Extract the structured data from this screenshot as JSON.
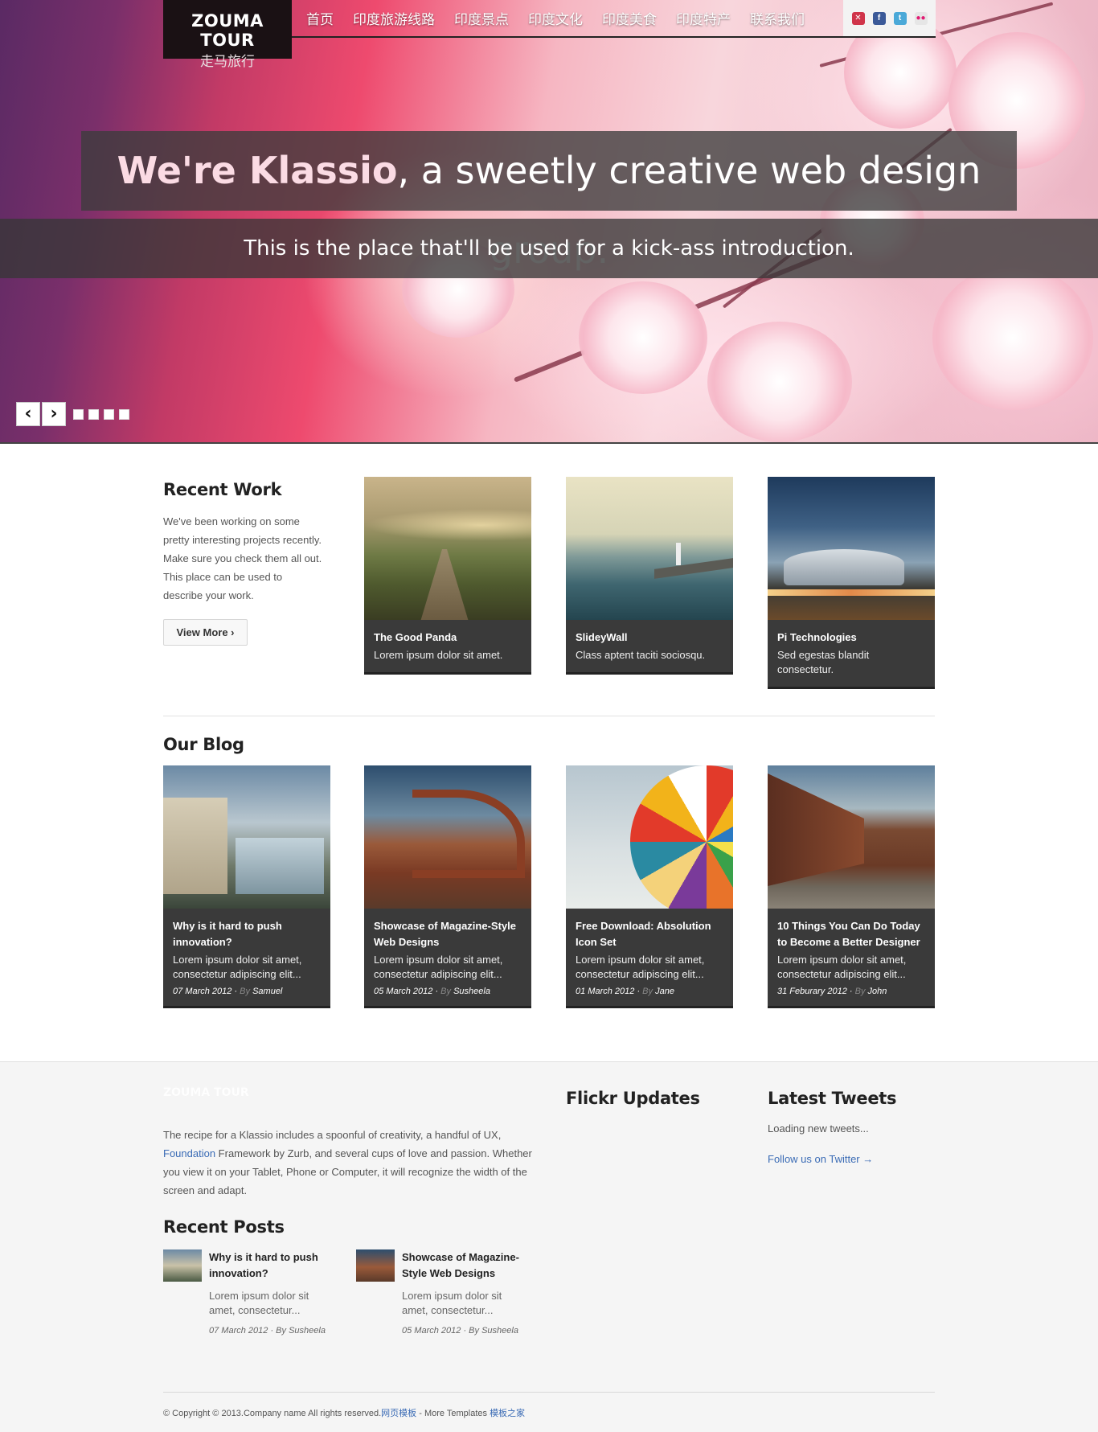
{
  "header": {
    "logo_main": "ZOUMA TOUR",
    "logo_sub": "走马旅行",
    "nav": [
      "首页",
      "印度旅游线路",
      "印度景点",
      "印度文化",
      "印度美食",
      "印度特产",
      "联系我们"
    ]
  },
  "hero": {
    "title_highlight": "We're Klassio",
    "title_rest": ", a sweetly creative web design group.",
    "subtitle": "This is the place that'll be used for a kick-ass introduction.",
    "prev_label": "‹",
    "next_label": "›"
  },
  "recent_work": {
    "heading": "Recent Work",
    "intro": "We've been working on some pretty interesting projects recently. Make sure you check them all out. This place can be used to describe your work.",
    "button": "View More ›",
    "items": [
      {
        "title": "The Good Panda",
        "desc": "Lorem ipsum dolor sit amet."
      },
      {
        "title": "SlideyWall",
        "desc": "Class aptent taciti sociosqu."
      },
      {
        "title": "Pi Technologies",
        "desc": "Sed egestas blandit consectetur."
      }
    ]
  },
  "blog": {
    "heading": "Our Blog",
    "by_label": "By",
    "posts": [
      {
        "title": "Why is it hard to push innovation?",
        "desc": "Lorem ipsum dolor sit amet, consectetur adipiscing elit...",
        "date": "07 March 2012",
        "author": "Samuel"
      },
      {
        "title": "Showcase of Magazine-Style Web Designs",
        "desc": "Lorem ipsum dolor sit amet, consectetur adipiscing elit...",
        "date": "05 March 2012",
        "author": "Susheela"
      },
      {
        "title": "Free Download: Absolution Icon Set",
        "desc": "Lorem ipsum dolor sit amet, consectetur adipiscing elit...",
        "date": "01 March 2012",
        "author": "Jane"
      },
      {
        "title": "10 Things You Can Do Today to Become a Better Designer",
        "desc": "Lorem ipsum dolor sit amet, consectetur adipiscing elit...",
        "date": "31 Feburary 2012",
        "author": "John"
      }
    ]
  },
  "footer": {
    "logo": "ZOUMA TOUR",
    "about_1": "The recipe for a Klassio includes a spoonful of creativity, a handful of UX, ",
    "about_link": "Foundation",
    "about_2": " Framework by Zurb, and several cups of love and passion. Whether you view it on your Tablet, Phone or Computer, it will recognize the width of the screen and adapt.",
    "recent_posts_heading": "Recent Posts",
    "recent_posts": [
      {
        "title": "Why is it hard to push innovation?",
        "desc": "Lorem ipsum dolor sit amet, consectetur...",
        "date": "07 March 2012",
        "author": "Susheela"
      },
      {
        "title": "Showcase of Magazine-Style Web Designs",
        "desc": "Lorem ipsum dolor sit amet, consectetur...",
        "date": "05 March 2012",
        "author": "Susheela"
      }
    ],
    "flickr_heading": "Flickr Updates",
    "tweets_heading": "Latest Tweets",
    "tweets_loading": "Loading new tweets...",
    "follow_link": "Follow us on Twitter →",
    "copyright_text": "© Copyright © 2013.Company name All rights reserved.",
    "copyright_link1": "网页模板",
    "copyright_mid": " - More Templates ",
    "copyright_link2": "模板之家"
  }
}
